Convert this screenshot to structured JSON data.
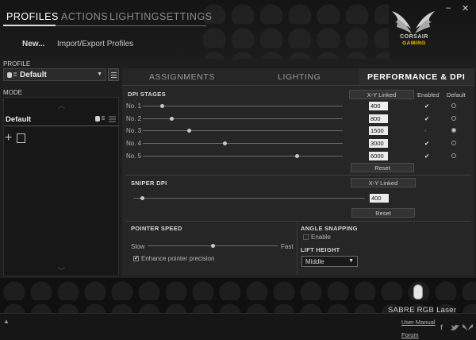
{
  "window": {
    "minimize": "–",
    "close": "✕"
  },
  "nav": {
    "tabs": [
      {
        "label": "PROFILES",
        "active": true
      },
      {
        "label": "ACTIONS",
        "active": false
      },
      {
        "label": "LIGHTING",
        "active": false
      },
      {
        "label": "SETTINGS",
        "active": false
      }
    ],
    "sub": {
      "new_label": "New...",
      "import_label": "Import/Export Profiles"
    }
  },
  "brand": {
    "line1": "CORSAIR",
    "line2": "GAMING",
    "accent": "#f0c000"
  },
  "sidebar": {
    "profile_label": "PROFILE",
    "profile_value": "Default",
    "mode_label": "MODE",
    "mode_item": "Default"
  },
  "main": {
    "tabs": [
      {
        "label": "ASSIGNMENTS",
        "active": false
      },
      {
        "label": "LIGHTING",
        "active": false
      },
      {
        "label": "PERFORMANCE & DPI",
        "active": true
      }
    ],
    "dpi_stages": {
      "title": "DPI STAGES",
      "xy_label": "X-Y Linked",
      "enabled_label": "Enabled",
      "default_label": "Default",
      "reset_label": "Reset",
      "max_dpi": 6000,
      "rows": [
        {
          "label": "No. 1",
          "value": "400",
          "enabled": true,
          "default": false
        },
        {
          "label": "No. 2",
          "value": "800",
          "enabled": true,
          "default": false
        },
        {
          "label": "No. 3",
          "value": "1500",
          "enabled": false,
          "default": true
        },
        {
          "label": "No. 4",
          "value": "3000",
          "enabled": true,
          "default": false
        },
        {
          "label": "No. 5",
          "value": "6000",
          "enabled": true,
          "default": false
        }
      ]
    },
    "sniper": {
      "title": "SNIPER DPI",
      "xy_label": "X-Y Linked",
      "value": "400",
      "reset_label": "Reset"
    },
    "pointer": {
      "title": "POINTER SPEED",
      "slow_label": "Slow",
      "fast_label": "Fast",
      "speed_fraction": 0.5,
      "enhance_label": "Enhance pointer precision",
      "enhance_checked": true
    },
    "angle": {
      "title": "ANGLE SNAPPING",
      "enable_label": "Enable",
      "enable_checked": false
    },
    "lift": {
      "title": "LIFT HEIGHT",
      "value": "Middle"
    }
  },
  "footer": {
    "device_name": "SABRE RGB Laser",
    "user_manual": "User Manual",
    "forum": "Forum",
    "collapse": "▲"
  }
}
